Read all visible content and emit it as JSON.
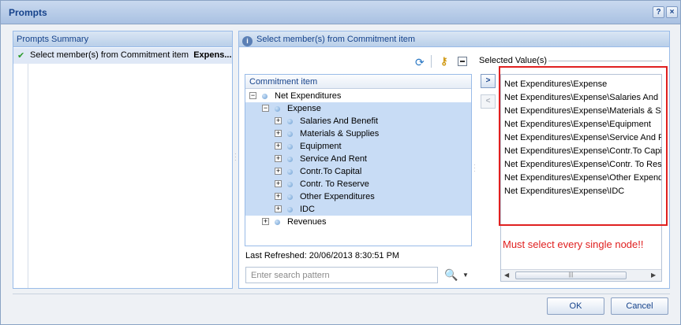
{
  "window": {
    "title": "Prompts",
    "help_icon": "question-mark-icon",
    "close_icon": "close-icon"
  },
  "left_panel": {
    "title": "Prompts Summary",
    "item": {
      "label": "Select member(s) from Commitment item",
      "value": "Expens..."
    }
  },
  "right_panel": {
    "title": "Select member(s) from Commitment item",
    "tree": {
      "column_header": "Commitment item",
      "nodes": [
        {
          "label": "Net Expenditures",
          "toggle": "−",
          "selected": false
        },
        {
          "label": "Expense",
          "toggle": "−",
          "selected": true
        },
        {
          "label": "Salaries And Benefit",
          "toggle": "+",
          "selected": true
        },
        {
          "label": "Materials & Supplies",
          "toggle": "+",
          "selected": true
        },
        {
          "label": "Equipment",
          "toggle": "+",
          "selected": true
        },
        {
          "label": "Service And Rent",
          "toggle": "+",
          "selected": true
        },
        {
          "label": "Contr.To Capital",
          "toggle": "+",
          "selected": true
        },
        {
          "label": "Contr. To Reserve",
          "toggle": "+",
          "selected": true
        },
        {
          "label": "Other Expenditures",
          "toggle": "+",
          "selected": true
        },
        {
          "label": "IDC",
          "toggle": "+",
          "selected": true
        },
        {
          "label": "Revenues",
          "toggle": "+",
          "selected": false
        }
      ]
    },
    "last_refreshed": "Last Refreshed: 20/06/2013 8:30:51 PM",
    "search": {
      "placeholder": "Enter search pattern",
      "value": ""
    },
    "selected_values": {
      "title": "Selected Value(s)",
      "add_label": ">",
      "remove_label": "<",
      "items": [
        "Net Expenditures\\Expense",
        "Net Expenditures\\Expense\\Salaries And B",
        "Net Expenditures\\Expense\\Materials & Su",
        "Net Expenditures\\Expense\\Equipment",
        "Net Expenditures\\Expense\\Service And R",
        "Net Expenditures\\Expense\\Contr.To Capit",
        "Net Expenditures\\Expense\\Contr. To Rese",
        "Net Expenditures\\Expense\\Other Expendi",
        "Net Expenditures\\Expense\\IDC"
      ]
    }
  },
  "annotation": {
    "text": "Must select every single node!!",
    "color": "#e02020"
  },
  "footer": {
    "ok_label": "OK",
    "cancel_label": "Cancel"
  },
  "colors": {
    "accent": "#15428b",
    "selection": "#c8dcf5",
    "border": "#99bbe8"
  }
}
